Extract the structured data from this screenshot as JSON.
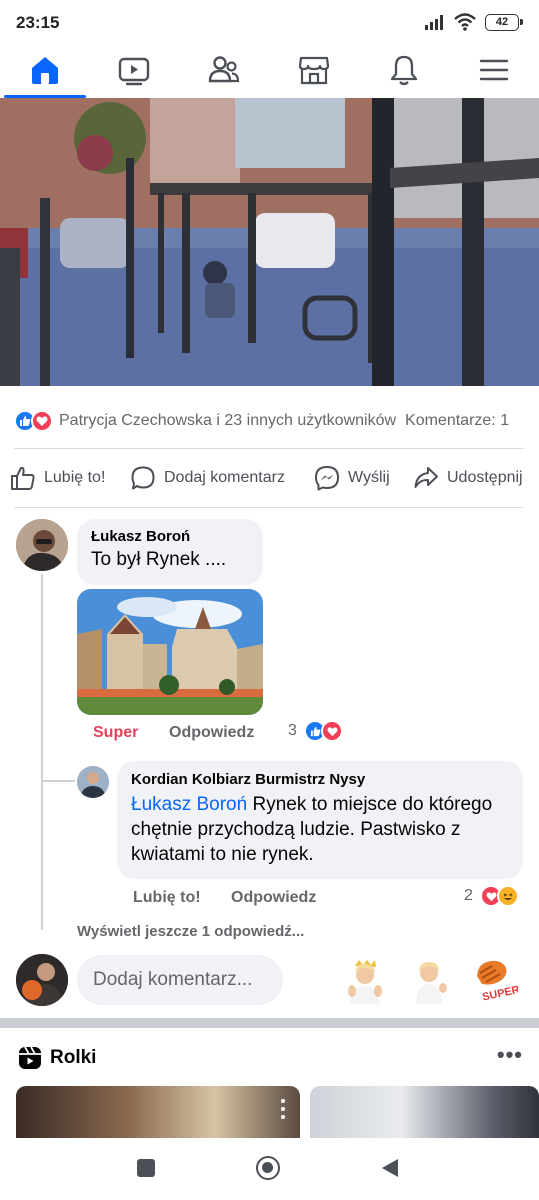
{
  "status_bar": {
    "time": "23:15",
    "battery": "42"
  },
  "nav": {
    "tabs": [
      "home-icon",
      "video-icon",
      "friends-icon",
      "marketplace-icon",
      "notifications-icon",
      "menu-icon"
    ],
    "active": "home",
    "accent": "#0866ff"
  },
  "post": {
    "reactions_text": "Patrycja Czechowska i 23 innych użytkowników",
    "comments_count": "Komentarze: 1",
    "actions": {
      "like": "Lubię to!",
      "comment": "Dodaj komentarz",
      "send": "Wyślij",
      "share": "Udostępnij"
    }
  },
  "comments": [
    {
      "author": "Łukasz Boroń",
      "text": "To był Rynek ....",
      "reaction_label": "Super",
      "reply_label": "Odpowiedz",
      "reaction_count": "3",
      "reply": {
        "author": "Kordian Kolbiarz Burmistrz Nysy",
        "mention": "Łukasz Boroń",
        "text": " Rynek to miejsce do którego chętnie przychodzą ludzie. Pastwisko z kwiatami to nie rynek.",
        "like_label": "Lubię to!",
        "reply_label": "Odpowiedz",
        "reaction_count": "2"
      }
    }
  ],
  "more_replies": "Wyświetl jeszcze 1 odpowiedź...",
  "composer": {
    "placeholder": "Dodaj komentarz..."
  },
  "stickers": [
    "avatar-sticker-clap",
    "avatar-sticker-thumb",
    "super-sticker"
  ],
  "reels": {
    "title": "Rolki",
    "more": "•••"
  },
  "colors": {
    "like_blue": "#1877f2",
    "love_red": "#f33e58",
    "super_red": "#e8405a",
    "text_gray": "#65676b"
  }
}
